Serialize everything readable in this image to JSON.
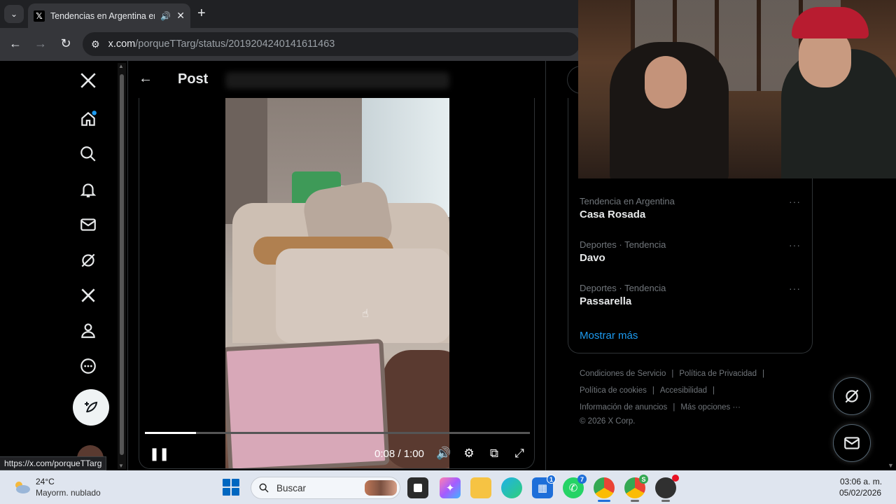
{
  "browser": {
    "tab_title": "Tendencias en Argentina en",
    "url_host": "x.com",
    "url_path": "/porqueTTarg/status/2019204240141611463",
    "status_url": "https://x.com/porqueTTarg"
  },
  "post": {
    "header_title": "Post"
  },
  "video": {
    "time_display": "0:08 / 1:00",
    "progress_fraction": 0.133
  },
  "trends": [
    {
      "meta": "Tendencia en Argentina",
      "name": "Casa Rosada"
    },
    {
      "meta": "Deportes · Tendencia",
      "name": "Davo"
    },
    {
      "meta": "Deportes · Tendencia",
      "name": "Passarella"
    }
  ],
  "show_more": "Mostrar más",
  "footer": {
    "terms": "Condiciones de Servicio",
    "privacy": "Política de Privacidad",
    "cookies": "Política de cookies",
    "accessibility": "Accesibilidad",
    "ads": "Información de anuncios",
    "more": "Más opciones ···",
    "copyright": "© 2026 X Corp."
  },
  "taskbar": {
    "temperature": "24°C",
    "weather": "Mayorm. nublado",
    "search_label": "Buscar",
    "badge_store": "1",
    "badge_whatsapp": "7",
    "badge_chrome2": "S",
    "time": "03:06 a. m.",
    "date": "05/02/2026"
  },
  "colors": {
    "accent": "#1d9bf0",
    "background": "#000000",
    "taskbar": "#dfe5ef"
  }
}
